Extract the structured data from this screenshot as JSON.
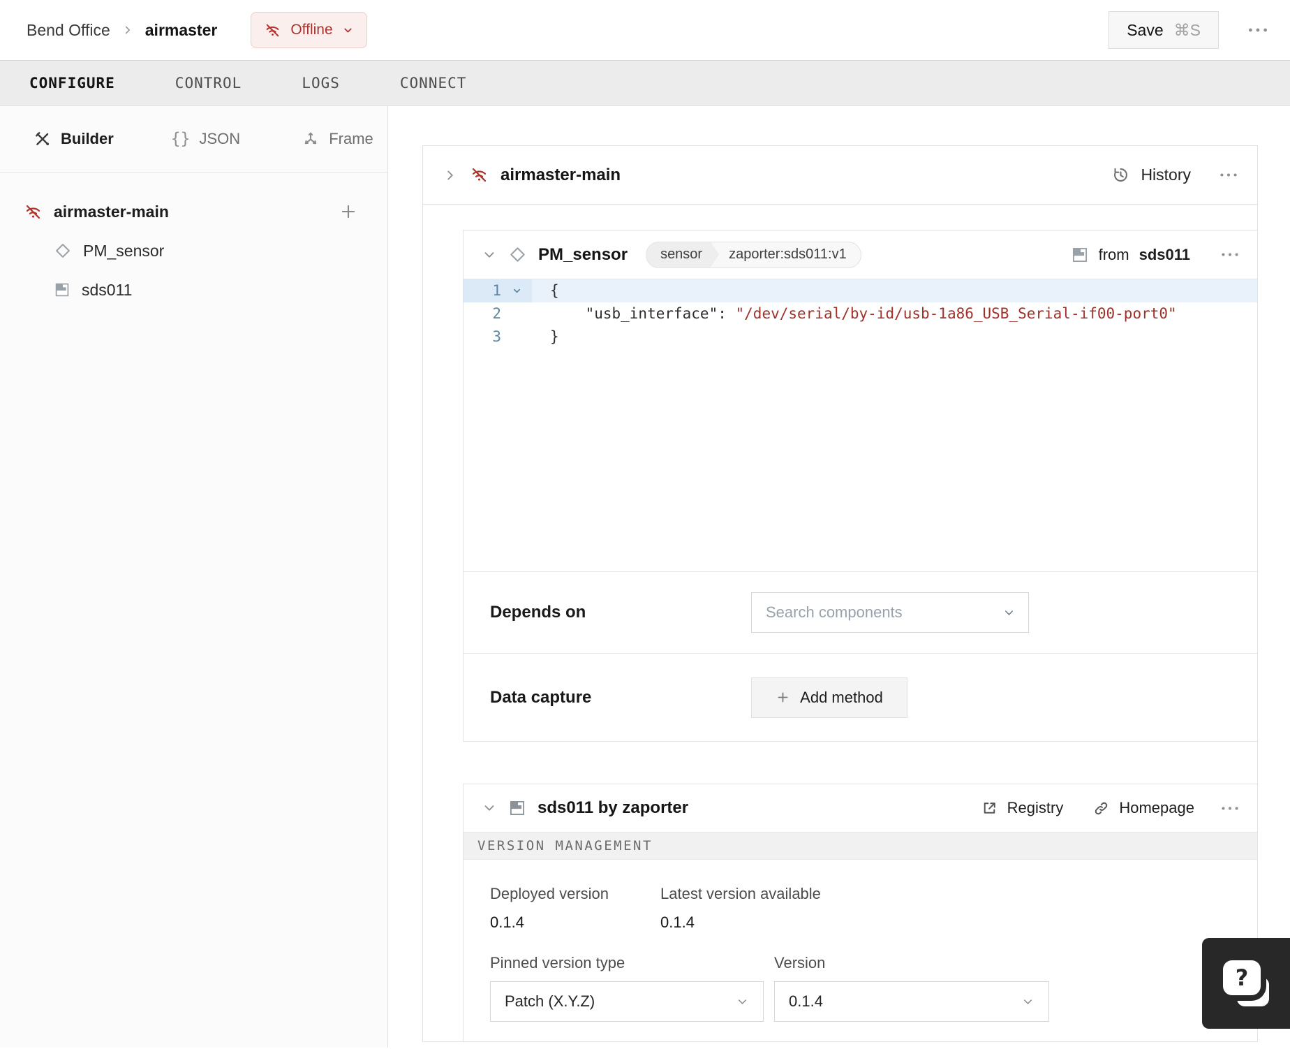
{
  "topbar": {
    "breadcrumb_root": "Bend Office",
    "breadcrumb_current": "airmaster",
    "status_label": "Offline",
    "save_label": "Save",
    "save_shortcut": "⌘S"
  },
  "tabs": [
    {
      "label": "CONFIGURE",
      "active": true
    },
    {
      "label": "CONTROL",
      "active": false
    },
    {
      "label": "LOGS",
      "active": false
    },
    {
      "label": "CONNECT",
      "active": false
    }
  ],
  "sidebar": {
    "modes": [
      {
        "label": "Builder",
        "icon": "tools-icon",
        "active": true
      },
      {
        "label": "JSON",
        "icon": "braces-icon",
        "active": false
      },
      {
        "label": "Frame",
        "icon": "frame-axes-icon",
        "active": false
      }
    ],
    "tree": [
      {
        "label": "airmaster-main",
        "icon": "offline-icon",
        "level": 0
      },
      {
        "label": "PM_sensor",
        "icon": "component-diamond-icon",
        "level": 1
      },
      {
        "label": "sds011",
        "icon": "module-icon",
        "level": 1
      }
    ]
  },
  "main": {
    "part": {
      "title": "airmaster-main",
      "history_label": "History"
    },
    "component_card": {
      "title": "PM_sensor",
      "badge_type": "sensor",
      "badge_model": "zaporter:sds011:v1",
      "from_prefix": "from",
      "from_module": "sds011",
      "code": {
        "lines": [
          {
            "num": "1",
            "tokens": [
              {
                "text": "{",
                "type": "plain"
              }
            ]
          },
          {
            "num": "2",
            "tokens": [
              {
                "text": "    \"usb_interface\"",
                "type": "key"
              },
              {
                "text": ": ",
                "type": "plain"
              },
              {
                "text": "\"/dev/serial/by-id/usb-1a86_USB_Serial-if00-port0\"",
                "type": "string"
              }
            ]
          },
          {
            "num": "3",
            "tokens": [
              {
                "text": "}",
                "type": "plain"
              }
            ]
          }
        ]
      },
      "depends_on": {
        "label": "Depends on",
        "placeholder": "Search components"
      },
      "data_capture": {
        "label": "Data capture",
        "button_label": "Add method"
      }
    },
    "module_card": {
      "title": "sds011 by zaporter",
      "registry_label": "Registry",
      "homepage_label": "Homepage",
      "section_title": "VERSION MANAGEMENT",
      "deployed": {
        "label": "Deployed version",
        "value": "0.1.4"
      },
      "latest": {
        "label": "Latest version available",
        "value": "0.1.4"
      },
      "pinned_type": {
        "label": "Pinned version type",
        "value": "Patch (X.Y.Z)"
      },
      "version": {
        "label": "Version",
        "value": "0.1.4"
      }
    }
  },
  "help": {
    "glyph": "?"
  },
  "colors": {
    "status_offline": "#b3332c",
    "status_offline_bg": "#fbefee",
    "code_string": "#a03029",
    "active_line_bg": "#e9f1fb",
    "card_border": "#e3e3e3",
    "tabbar_bg": "#ececec"
  }
}
